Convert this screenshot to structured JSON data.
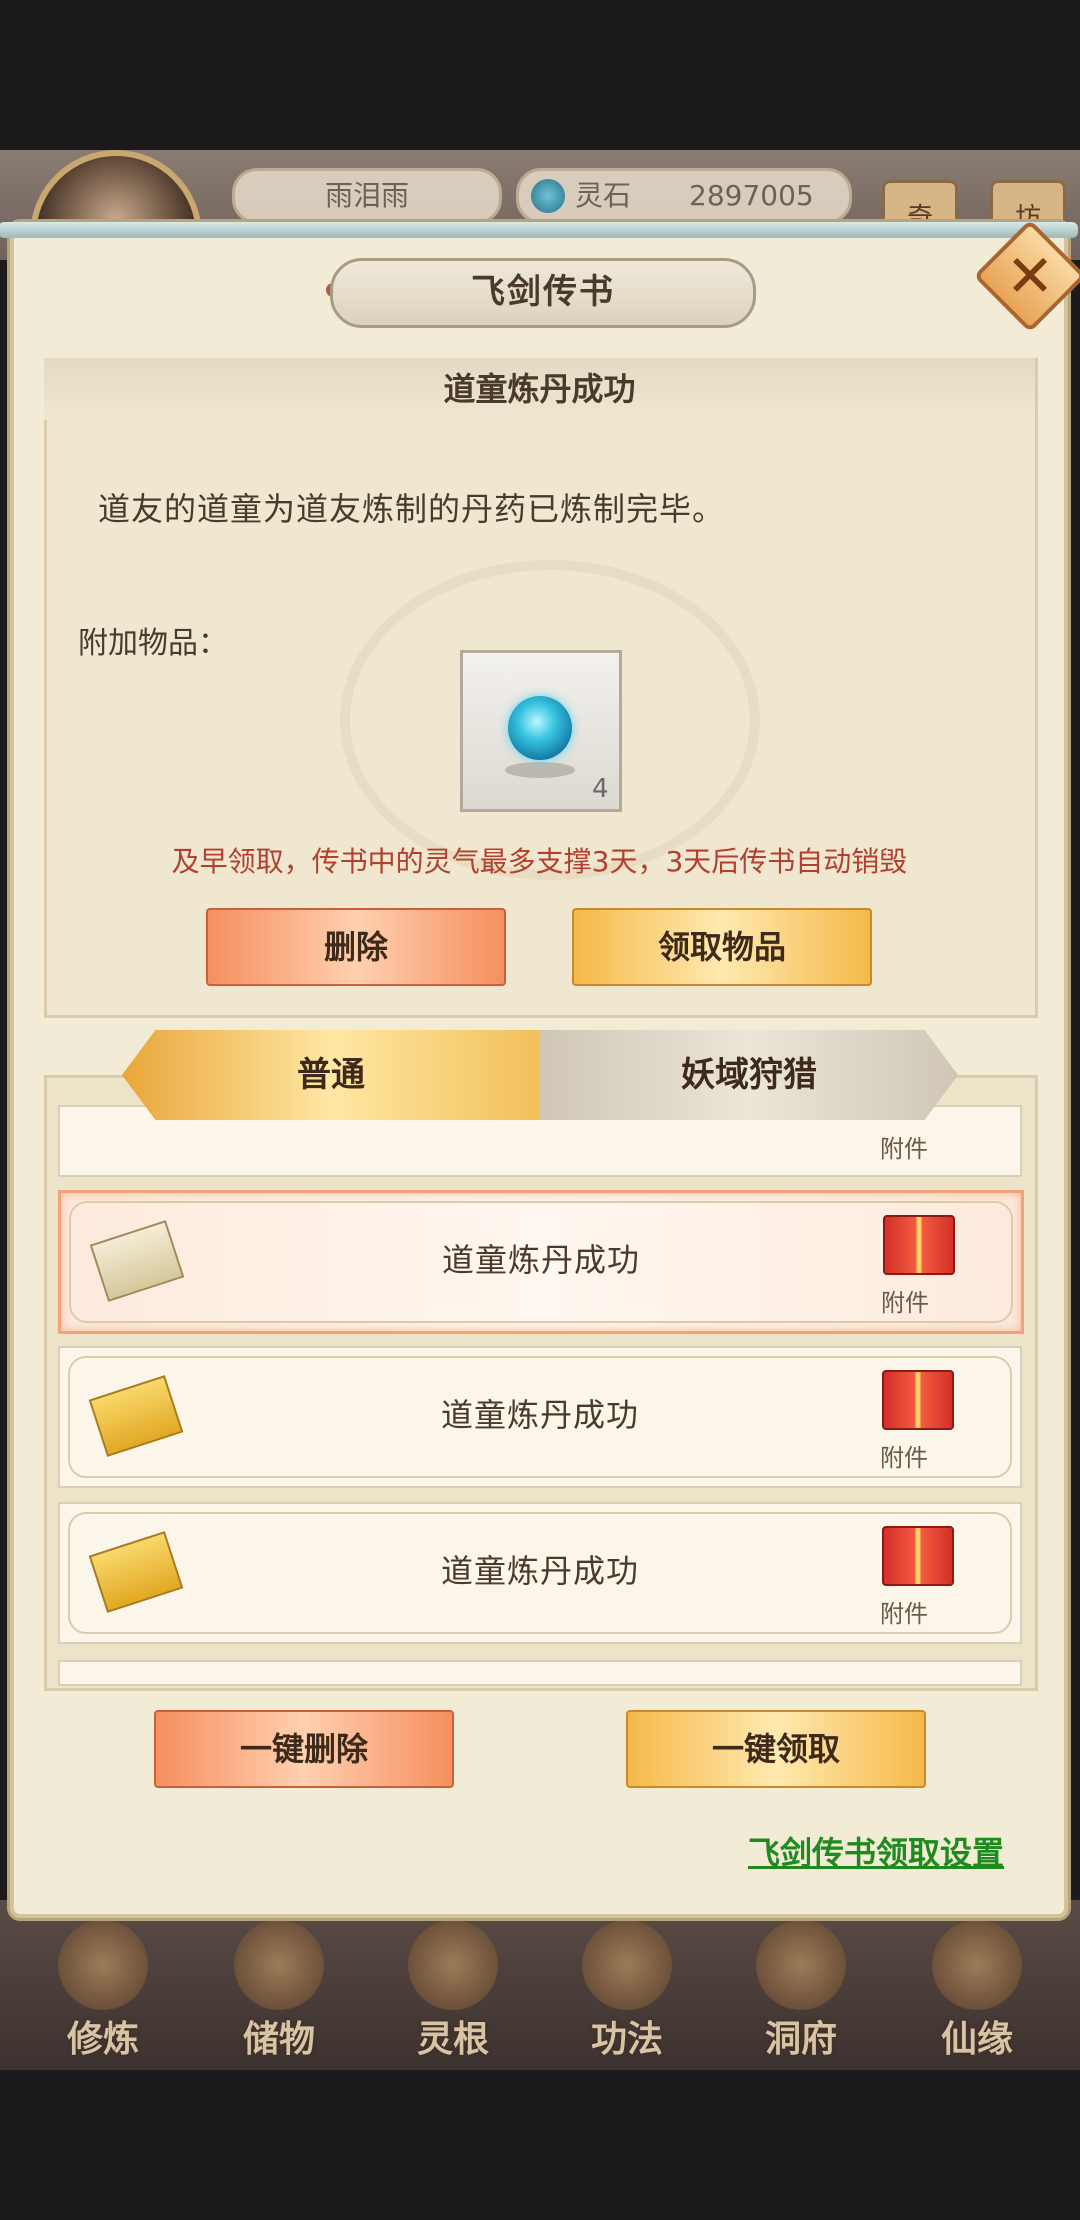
{
  "header": {
    "player_name": "雨泪雨",
    "currency_label": "灵石",
    "currency_value": "2897005",
    "side_tags": [
      "奇",
      "坊"
    ]
  },
  "dialog": {
    "title": "飞剑传书",
    "close_icon": "close-icon"
  },
  "mail": {
    "title": "道童炼丹成功",
    "body": "道友的道童为道友炼制的丹药已炼制完毕。",
    "attach_label": "附加物品：",
    "item_count": "4",
    "warning": "及早领取，传书中的灵气最多支撑3天，3天后传书自动销毁",
    "delete_label": "删除",
    "claim_label": "领取物品"
  },
  "tabs": {
    "normal": "普通",
    "hunt": "妖域狩猎"
  },
  "list": {
    "attachment_label": "附件",
    "rows": [
      {
        "title": "道童炼丹成功",
        "selected": true
      },
      {
        "title": "道童炼丹成功",
        "selected": false
      },
      {
        "title": "道童炼丹成功",
        "selected": false
      }
    ]
  },
  "actions": {
    "delete_all": "一键删除",
    "claim_all": "一键领取",
    "settings_link": "飞剑传书领取设置"
  },
  "bottom_nav": [
    {
      "label": "修炼"
    },
    {
      "label": "储物"
    },
    {
      "label": "灵根"
    },
    {
      "label": "功法"
    },
    {
      "label": "洞府"
    },
    {
      "label": "仙缘"
    }
  ],
  "colors": {
    "warning": "#b3402e",
    "link": "#1f8a1e",
    "accent_orange": "#f58f5f",
    "accent_yellow": "#f5b94a"
  }
}
